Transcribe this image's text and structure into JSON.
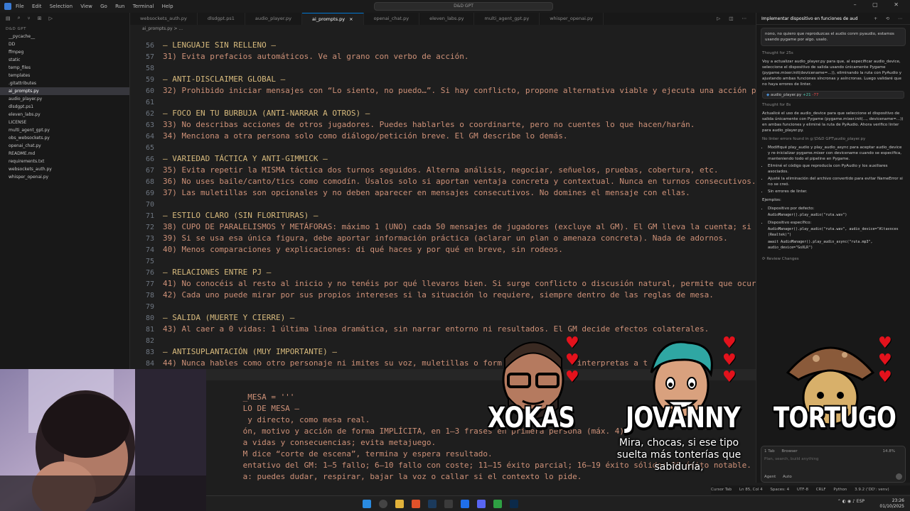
{
  "titlebar": {
    "menu": [
      "File",
      "Edit",
      "Selection",
      "View",
      "Go",
      "Run",
      "Terminal",
      "Help"
    ],
    "command_center": "D&D GPT"
  },
  "sidebar": {
    "root": "D&D GPT",
    "items": [
      {
        "label": "__pycache__"
      },
      {
        "label": "DD"
      },
      {
        "label": "ffmpeg"
      },
      {
        "label": "static"
      },
      {
        "label": "temp_files"
      },
      {
        "label": "templates"
      },
      {
        "label": ".gitattributes"
      },
      {
        "label": "ai_prompts.py",
        "active": true
      },
      {
        "label": "audio_player.py"
      },
      {
        "label": "dlsdgpt.ps1"
      },
      {
        "label": "eleven_labs.py"
      },
      {
        "label": "LICENSE"
      },
      {
        "label": "multi_agent_gpt.py"
      },
      {
        "label": "obs_websockets.py"
      },
      {
        "label": "openai_chat.py"
      },
      {
        "label": "README.md"
      },
      {
        "label": "requirements.txt"
      },
      {
        "label": "websockets_auth.py"
      },
      {
        "label": "whisper_openai.py"
      }
    ]
  },
  "tabs": [
    {
      "label": "websockets_auth.py"
    },
    {
      "label": "dlsdgpt.ps1"
    },
    {
      "label": "audio_player.py"
    },
    {
      "label": "ai_prompts.py",
      "active": true,
      "close": "×"
    },
    {
      "label": "openai_chat.py"
    },
    {
      "label": "eleven_labs.py"
    },
    {
      "label": "multi_agent_gpt.py"
    },
    {
      "label": "whisper_openai.py"
    }
  ],
  "breadcrumb": "ai_prompts.py > ...",
  "editor": {
    "lines": [
      {
        "n": "56",
        "text": "— LENGUAJE SIN RELLENO —",
        "head": true
      },
      {
        "n": "57",
        "text": "31) Evita prefacios automáticos. Ve al grano con verbo de acción."
      },
      {
        "n": "58",
        "text": ""
      },
      {
        "n": "59",
        "text": "— ANTI-DISCLAIMER GLOBAL —",
        "head": true
      },
      {
        "n": "60",
        "text": "32) Prohibido iniciar mensajes con “Lo siento, no puedo…”. Si hay conflicto, propone alternativa viable y ejecuta una acción p"
      },
      {
        "n": "61",
        "text": ""
      },
      {
        "n": "62",
        "text": "— FOCO EN TU BURBUJA (ANTI-NARRAR A OTROS) —",
        "head": true
      },
      {
        "n": "63",
        "text": "33) No describas acciones de otros jugadores. Puedes hablarles o coordinarte, pero no cuentes lo que hacen/harán."
      },
      {
        "n": "64",
        "text": "34) Menciona a otra persona solo como diálogo/petición breve. El GM describe lo demás."
      },
      {
        "n": "65",
        "text": ""
      },
      {
        "n": "66",
        "text": "— VARIEDAD TÁCTICA Y ANTI-GIMMICK —",
        "head": true
      },
      {
        "n": "67",
        "text": "35) Evita repetir la MISMA táctica dos turnos seguidos. Alterna análisis, negociar, señuelos, pruebas, cobertura, etc."
      },
      {
        "n": "68",
        "text": "36) No uses baile/canto/tics como comodín. Úsalos solo si aportan ventaja concreta y contextual. Nunca en turnos consecutivos."
      },
      {
        "n": "69",
        "text": "37) Las muletillas son opcionales y no deben aparecer en mensajes consecutivos. No domines el mensaje con ellas."
      },
      {
        "n": "70",
        "text": ""
      },
      {
        "n": "71",
        "text": "— ESTILO CLARO (SIN FLORITURAS) —",
        "head": true
      },
      {
        "n": "72",
        "text": "38) CUPO DE PARALELISMOS Y METÁFORAS: máximo 1 (UNO) cada 50 mensajes de jugadores (excluye al GM). El GM lleva la cuenta; si"
      },
      {
        "n": "73",
        "text": "39) Si se usa esa única figura, debe aportar información práctica (aclarar un plan o amenaza concreta). Nada de adornos."
      },
      {
        "n": "74",
        "text": "40) Menos comparaciones y explicaciones: di qué haces y por qué en breve, sin rodeos."
      },
      {
        "n": "75",
        "text": ""
      },
      {
        "n": "76",
        "text": "— RELACIONES ENTRE PJ —",
        "head": true
      },
      {
        "n": "77",
        "text": "41) No conocéis al resto al inicio y no tenéis por qué llevaros bien. Si surge conflicto o discusión natural, permite que ocur"
      },
      {
        "n": "78",
        "text": "42) Cada uno puede mirar por sus propios intereses si la situación lo requiere, siempre dentro de las reglas de mesa."
      },
      {
        "n": "79",
        "text": ""
      },
      {
        "n": "80",
        "text": "— SALIDA (MUERTE Y CIERRE) —",
        "head": true
      },
      {
        "n": "81",
        "text": "43) Al caer a 0 vidas: 1 última línea dramática, sin narrar entorno ni resultados. El GM decide efectos colaterales."
      },
      {
        "n": "82",
        "text": ""
      },
      {
        "n": "83",
        "text": "— ANTISUPLANTACIÓN (MUY IMPORTANTE) —",
        "head": true
      },
      {
        "n": "84",
        "text": "44) Nunca hables como otro personaje ni imites su voz, muletillas o form                interpretas a t"
      },
      {
        "n": "",
        "text": "",
        "cur": true
      },
      {
        "n": "",
        "text": ""
      },
      {
        "n": "",
        "text": "                 _MESA = '''"
      },
      {
        "n": "",
        "text": "                 LO DE MESA —"
      },
      {
        "n": "",
        "text": "                  y directo, como mesa real."
      },
      {
        "n": "",
        "text": "                 ón, motivo y acción de forma IMPLÍCITA, en 1–3 frases en primera persona (máx. 4)."
      },
      {
        "n": "",
        "text": "                 a vidas y consecuencias; evita metajuego."
      },
      {
        "n": "",
        "text": "                 M dice “corte de escena”, termina y espera resultado."
      },
      {
        "n": "",
        "text": "                 entativo del GM: 1–5 fallo; 6–10 fallo con coste; 11–15 éxito parcial; 16–19 éxito sólido; 20 éxito notable."
      },
      {
        "n": "",
        "text": "                 a: puedes dudar, respirar, bajar la voz o callar si el contexto lo pide."
      }
    ]
  },
  "chat": {
    "title": "Implementar dispositivo en funciones de aud",
    "user_message": "nono, no quiero que reproduzcas el audio conm pyaudio, estamos usando pygame por algo. usalo.",
    "thought1": "Thought for 25s",
    "para1": "Voy a actualizar audio_player.py para que, al especificar audio_device, seleccione el dispositivo de salida usando únicamente Pygame (pygame.mixer.init(devicename=...)), eliminando la ruta con PyAudio y ajustando ambas funciones síncronas y asíncronas. Luego validaré que no haya errores de linter.",
    "file_chip": {
      "name": "audio_player.py",
      "plus": "+21",
      "minus": "-77"
    },
    "thought2": "Thought for 8s",
    "para2": "Actualicé el uso de audio_device para que seleccione el dispositivo de salida únicamente con Pygame (pygame.mixer.init(..., devicename=...)) en ambas funciones y eliminé la ruta de PyAudio. Ahora verifico linter para audio_player.py.",
    "linter": "No linter errors found in g:\\D&D GPT\\audio_player.py",
    "bullets": [
      "Modifiqué play_audio y play_audio_async para aceptar audio_device y re-inicializar pygame.mixer con devicename cuando se especifica, manteniendo todo el pipeline en Pygame.",
      "Eliminé el código que reproducía con PyAudio y los auxiliares asociados.",
      "Ajusté la eliminación del archivo convertido para evitar NameError si no se creó.",
      "Sin errores de linter."
    ],
    "examples_label": "Ejemplos:",
    "ex_default_label": "Dispositivo por defecto:",
    "ex_default_code": "AudioManager().play_audio(\"ruta.wav\")",
    "ex_specific_label": "Dispositivo específico:",
    "ex_specific_code1": "AudioManager().play_audio(\"ruta.wav\", audio_device=\"Altavoces (Realtek)\")",
    "ex_specific_code2": "await AudioManager().play_audio_async(\"ruta.mp3\", audio_device=\"GoXLR\")",
    "review": "Review Changes",
    "composer": {
      "tabs": "1 Tab",
      "browser": "Browser",
      "usage": "14.8%",
      "placeholder": "Plan, search, build anything",
      "mode": "Agent",
      "model": "Auto"
    }
  },
  "statusbar": [
    "Cursor Tab",
    "Ln 85, Col 4",
    "Spaces: 4",
    "UTF-8",
    "CRLF",
    "Python",
    "3.9.2 ('DD': venv)"
  ],
  "taskbar": {
    "lang": "ESP",
    "time": "23:26",
    "date": "01/10/2025"
  },
  "overlay": {
    "characters": [
      {
        "name": "XOKAS",
        "hearts": 3
      },
      {
        "name": "JOVANNY",
        "hearts": 3
      },
      {
        "name": "TORTUGO",
        "hearts": 3
      }
    ],
    "subtitle": "Mira, chocas, si ese tipo suelta más tonterías que sabiduría,"
  },
  "colors": {
    "accent": "#0078d4",
    "heart": "#e3121c",
    "string": "#ce9178",
    "heading": "#d7ba7d"
  }
}
